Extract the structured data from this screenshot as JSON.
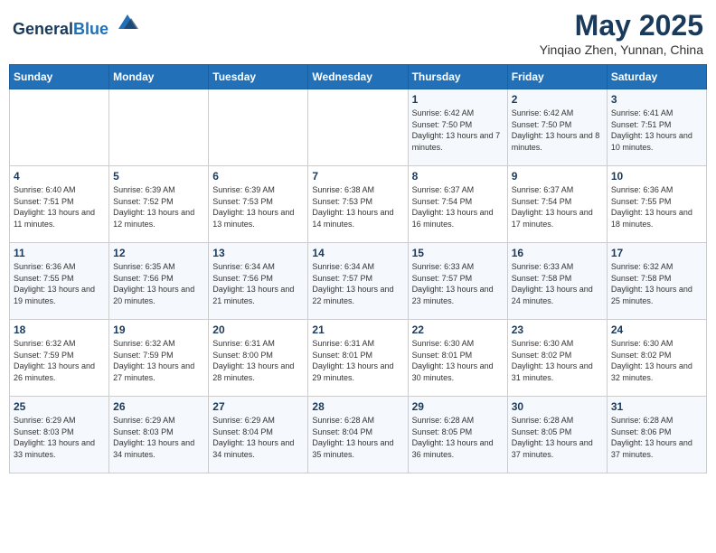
{
  "header": {
    "logo_general": "General",
    "logo_blue": "Blue",
    "month_year": "May 2025",
    "location": "Yinqiao Zhen, Yunnan, China"
  },
  "weekdays": [
    "Sunday",
    "Monday",
    "Tuesday",
    "Wednesday",
    "Thursday",
    "Friday",
    "Saturday"
  ],
  "weeks": [
    [
      {
        "day": "",
        "info": ""
      },
      {
        "day": "",
        "info": ""
      },
      {
        "day": "",
        "info": ""
      },
      {
        "day": "",
        "info": ""
      },
      {
        "day": "1",
        "info": "Sunrise: 6:42 AM\nSunset: 7:50 PM\nDaylight: 13 hours and 7 minutes."
      },
      {
        "day": "2",
        "info": "Sunrise: 6:42 AM\nSunset: 7:50 PM\nDaylight: 13 hours and 8 minutes."
      },
      {
        "day": "3",
        "info": "Sunrise: 6:41 AM\nSunset: 7:51 PM\nDaylight: 13 hours and 10 minutes."
      }
    ],
    [
      {
        "day": "4",
        "info": "Sunrise: 6:40 AM\nSunset: 7:51 PM\nDaylight: 13 hours and 11 minutes."
      },
      {
        "day": "5",
        "info": "Sunrise: 6:39 AM\nSunset: 7:52 PM\nDaylight: 13 hours and 12 minutes."
      },
      {
        "day": "6",
        "info": "Sunrise: 6:39 AM\nSunset: 7:53 PM\nDaylight: 13 hours and 13 minutes."
      },
      {
        "day": "7",
        "info": "Sunrise: 6:38 AM\nSunset: 7:53 PM\nDaylight: 13 hours and 14 minutes."
      },
      {
        "day": "8",
        "info": "Sunrise: 6:37 AM\nSunset: 7:54 PM\nDaylight: 13 hours and 16 minutes."
      },
      {
        "day": "9",
        "info": "Sunrise: 6:37 AM\nSunset: 7:54 PM\nDaylight: 13 hours and 17 minutes."
      },
      {
        "day": "10",
        "info": "Sunrise: 6:36 AM\nSunset: 7:55 PM\nDaylight: 13 hours and 18 minutes."
      }
    ],
    [
      {
        "day": "11",
        "info": "Sunrise: 6:36 AM\nSunset: 7:55 PM\nDaylight: 13 hours and 19 minutes."
      },
      {
        "day": "12",
        "info": "Sunrise: 6:35 AM\nSunset: 7:56 PM\nDaylight: 13 hours and 20 minutes."
      },
      {
        "day": "13",
        "info": "Sunrise: 6:34 AM\nSunset: 7:56 PM\nDaylight: 13 hours and 21 minutes."
      },
      {
        "day": "14",
        "info": "Sunrise: 6:34 AM\nSunset: 7:57 PM\nDaylight: 13 hours and 22 minutes."
      },
      {
        "day": "15",
        "info": "Sunrise: 6:33 AM\nSunset: 7:57 PM\nDaylight: 13 hours and 23 minutes."
      },
      {
        "day": "16",
        "info": "Sunrise: 6:33 AM\nSunset: 7:58 PM\nDaylight: 13 hours and 24 minutes."
      },
      {
        "day": "17",
        "info": "Sunrise: 6:32 AM\nSunset: 7:58 PM\nDaylight: 13 hours and 25 minutes."
      }
    ],
    [
      {
        "day": "18",
        "info": "Sunrise: 6:32 AM\nSunset: 7:59 PM\nDaylight: 13 hours and 26 minutes."
      },
      {
        "day": "19",
        "info": "Sunrise: 6:32 AM\nSunset: 7:59 PM\nDaylight: 13 hours and 27 minutes."
      },
      {
        "day": "20",
        "info": "Sunrise: 6:31 AM\nSunset: 8:00 PM\nDaylight: 13 hours and 28 minutes."
      },
      {
        "day": "21",
        "info": "Sunrise: 6:31 AM\nSunset: 8:01 PM\nDaylight: 13 hours and 29 minutes."
      },
      {
        "day": "22",
        "info": "Sunrise: 6:30 AM\nSunset: 8:01 PM\nDaylight: 13 hours and 30 minutes."
      },
      {
        "day": "23",
        "info": "Sunrise: 6:30 AM\nSunset: 8:02 PM\nDaylight: 13 hours and 31 minutes."
      },
      {
        "day": "24",
        "info": "Sunrise: 6:30 AM\nSunset: 8:02 PM\nDaylight: 13 hours and 32 minutes."
      }
    ],
    [
      {
        "day": "25",
        "info": "Sunrise: 6:29 AM\nSunset: 8:03 PM\nDaylight: 13 hours and 33 minutes."
      },
      {
        "day": "26",
        "info": "Sunrise: 6:29 AM\nSunset: 8:03 PM\nDaylight: 13 hours and 34 minutes."
      },
      {
        "day": "27",
        "info": "Sunrise: 6:29 AM\nSunset: 8:04 PM\nDaylight: 13 hours and 34 minutes."
      },
      {
        "day": "28",
        "info": "Sunrise: 6:28 AM\nSunset: 8:04 PM\nDaylight: 13 hours and 35 minutes."
      },
      {
        "day": "29",
        "info": "Sunrise: 6:28 AM\nSunset: 8:05 PM\nDaylight: 13 hours and 36 minutes."
      },
      {
        "day": "30",
        "info": "Sunrise: 6:28 AM\nSunset: 8:05 PM\nDaylight: 13 hours and 37 minutes."
      },
      {
        "day": "31",
        "info": "Sunrise: 6:28 AM\nSunset: 8:06 PM\nDaylight: 13 hours and 37 minutes."
      }
    ]
  ]
}
